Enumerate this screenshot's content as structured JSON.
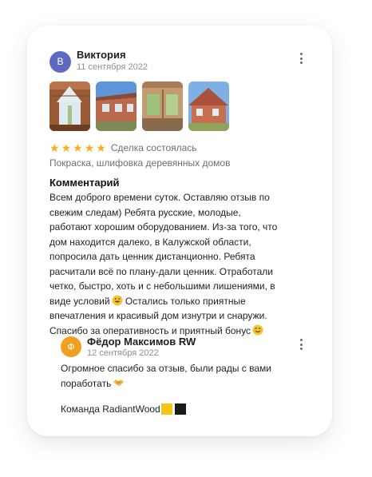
{
  "review": {
    "author_initial": "В",
    "author_name": "Виктория",
    "date": "11 сентября 2022",
    "rating": 5,
    "deal_status": "Сделка состоялась",
    "service": "Покраска, шлифовка деревянных домов",
    "comment_heading": "Комментарий",
    "comment_lines": [
      "Всем доброго времени суток.  Оставляю отзыв по",
      "свежим следам) Ребята русские, молодые,",
      "работают хорошим оборудованием. Из-за того, что",
      "дом находится далеко, в Калужской области,",
      "попросила дать ценник дистанционно. Ребята",
      "расчитали всё по плану-дали ценник. Отработали",
      "четко, быстро, хоть и с небольшими лишениями, в",
      "виде условий",
      " Остались только приятные",
      "впечатления и красивый дом изнутри и снаружи.",
      "Спасибо за оперативность и приятный бонус"
    ],
    "photo_count": 4
  },
  "reply": {
    "author_initial": "Ф",
    "author_name": "Фёдор Максимов RW",
    "date": "12 сентября 2022",
    "text_lines": [
      "Огромное спасибо за отзыв, были рады с вами",
      "поработать"
    ],
    "signature": "Команда RadiantWood"
  },
  "colors": {
    "avatar_reviewer": "#5c6bc0",
    "avatar_reply": "#f0a020",
    "star": "#f4b01c",
    "muted_text": "#8f8f8f"
  },
  "icons": {
    "menu": "kebab-menu-icon",
    "star": "star-icon",
    "emoji_grin": "grinning-sweat-emoji",
    "emoji_smile": "smiling-emoji",
    "emoji_handshake": "handshake-emoji",
    "square_yellow": "yellow-square-emoji",
    "square_black": "black-square-emoji"
  }
}
